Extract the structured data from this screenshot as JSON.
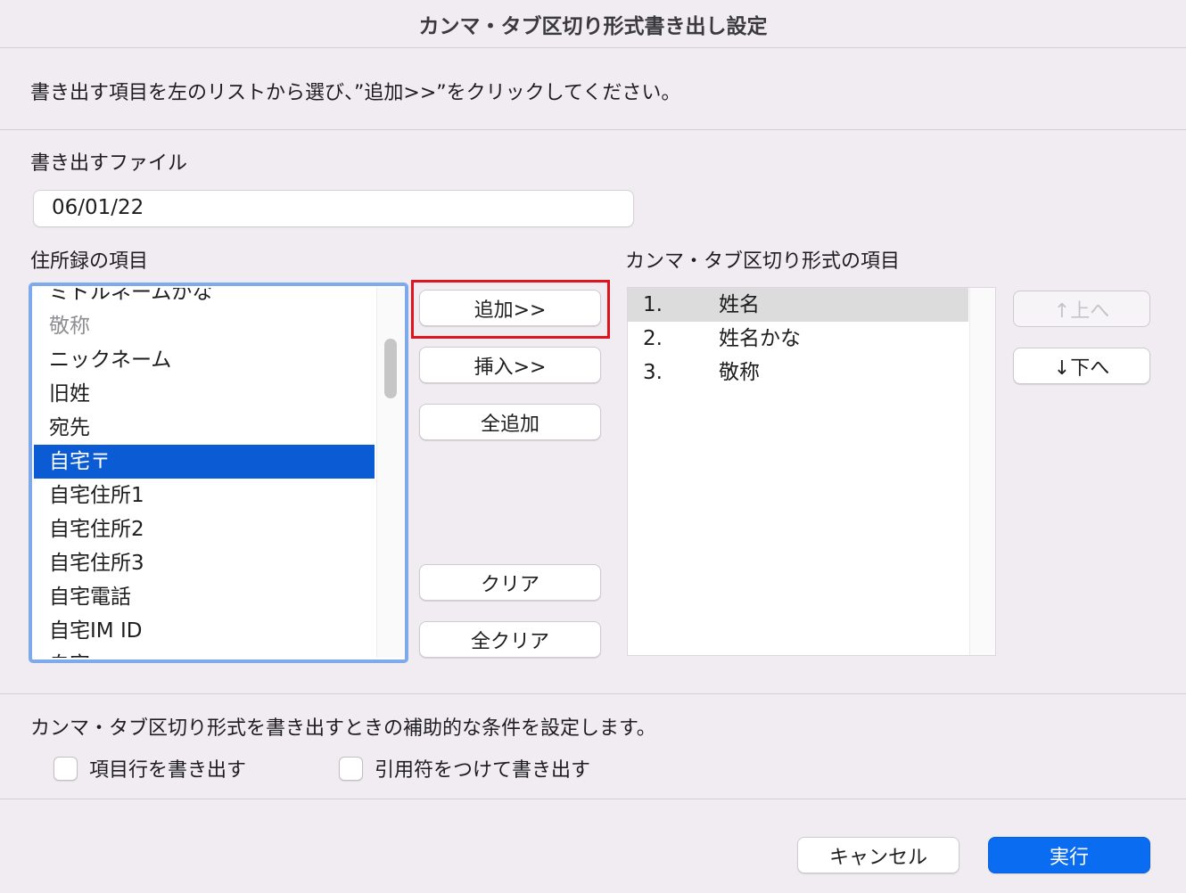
{
  "window": {
    "title": "カンマ・タブ区切り形式書き出し設定"
  },
  "instruction": "書き出す項目を左のリストから選び、”追加>>”をクリックしてください。",
  "file_section": {
    "label": "書き出すファイル",
    "value": "06/01/22"
  },
  "source_list": {
    "label": "住所録の項目",
    "items": [
      "ミドルネームかな",
      "敬称",
      "ニックネーム",
      "旧姓",
      "宛先",
      "自宅〒",
      "自宅住所1",
      "自宅住所2",
      "自宅住所3",
      "自宅電話",
      "自宅IM ID",
      "自宅"
    ],
    "selected": "自宅〒"
  },
  "middle_buttons": {
    "add": "追加>>",
    "insert": "挿入>>",
    "add_all": "全追加",
    "clear": "クリア",
    "clear_all": "全クリア"
  },
  "target_list": {
    "label": "カンマ・タブ区切り形式の項目",
    "items": [
      {
        "num": "1.",
        "name": "姓名"
      },
      {
        "num": "2.",
        "name": "姓名かな"
      },
      {
        "num": "3.",
        "name": "敬称"
      }
    ]
  },
  "order_buttons": {
    "up": "↑上へ",
    "down": "↓下へ"
  },
  "options": {
    "description": "カンマ・タブ区切り形式を書き出すときの補助的な条件を設定します。",
    "header_row": "項目行を書き出す",
    "quote": "引用符をつけて書き出す"
  },
  "footer": {
    "cancel": "キャンセル",
    "run": "実行"
  },
  "colors": {
    "accent": "#0a6cf0",
    "selection": "#0a5bd4",
    "highlight": "#e0141e"
  }
}
